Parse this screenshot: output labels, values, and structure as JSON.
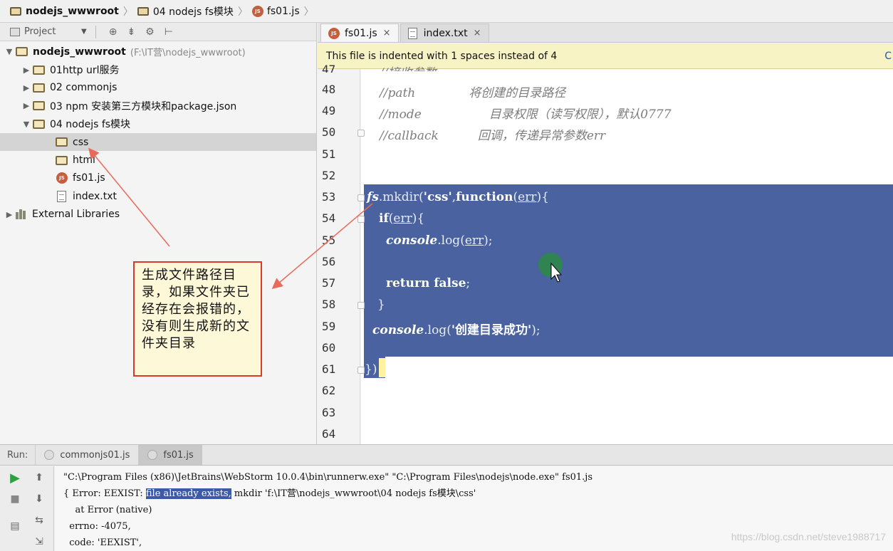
{
  "breadcrumb": {
    "items": [
      "nodejs_wwwroot",
      "04 nodejs fs模块",
      "fs01.js"
    ]
  },
  "project_panel": {
    "title": "Project",
    "root": {
      "name": "nodejs_wwwroot",
      "path": "(F:\\IT营\\nodejs_wwwroot)"
    },
    "items": [
      {
        "label": "01http url服务"
      },
      {
        "label": "02 commonjs"
      },
      {
        "label": "03 npm 安装第三方模块和package.json"
      },
      {
        "label": "04 nodejs fs模块"
      },
      {
        "label": "css"
      },
      {
        "label": "html"
      },
      {
        "label": "fs01.js"
      },
      {
        "label": "index.txt"
      },
      {
        "label": "External Libraries"
      }
    ]
  },
  "callout": {
    "text": "生成文件路径目录，如果文件夹已经存在会报错的，没有则生成新的文件夹目录"
  },
  "editor": {
    "tabs": [
      {
        "label": "fs01.js",
        "close": "×"
      },
      {
        "label": "index.txt",
        "close": "×"
      }
    ],
    "notice": "This file is indented with 1 spaces instead of 4",
    "notice_edge": "C",
    "line_numbers": [
      "47",
      "48",
      "49",
      "50",
      "51",
      "52",
      "53",
      "54",
      "55",
      "56",
      "57",
      "58",
      "59",
      "60",
      "61",
      "62",
      "63",
      "64"
    ],
    "code": {
      "l47": "//接收参数:",
      "l48a": "//path",
      "l48b": "将创建的目录路径",
      "l49a": "//mode",
      "l49b": "目录权限（读写权限），默认0777",
      "l50a": "//callback",
      "l50b": "回调，传递异常参数err",
      "l53_fs": "fs",
      "l53_rest": ".mkdir(",
      "l53_str": "'css'",
      "l53_comma": ",",
      "l53_fn": "function",
      "l53_open": "(",
      "l53_err": "err",
      "l53_close": "){",
      "l54_if": "if",
      "l54_open": "(",
      "l54_err": "err",
      "l54_close": "){",
      "l55_console": "console",
      "l55_log": ".log(",
      "l55_err": "err",
      "l55_close": ");",
      "l57_ret": "return false",
      "l57_semi": ";",
      "l58": "}",
      "l59_console": "console",
      "l59_log": ".log(",
      "l59_str": "'创建目录成功'",
      "l59_close": ");",
      "l61": "})"
    }
  },
  "run_panel": {
    "label": "Run:",
    "tabs": [
      "commonjs01.js",
      "fs01.js"
    ],
    "console": {
      "line1": "\"C:\\Program Files (x86)\\JetBrains\\WebStorm 10.0.4\\bin\\runnerw.exe\" \"C:\\Program Files\\nodejs\\node.exe\" fs01.js",
      "line2_pre": "{ Error: EEXIST: ",
      "line2_hl": "file already exists,",
      "line2_post": " mkdir 'f:\\IT营\\nodejs_wwwroot\\04 nodejs fs模块\\css'",
      "line3": "    at Error (native)",
      "line4": "  errno: -4075,",
      "line5": "  code: 'EEXIST',"
    }
  },
  "watermark": "https://blog.csdn.net/steve1988717",
  "colors": {
    "selection": "#4a63a0",
    "callout_border": "#d93a2a",
    "notice_bg": "#f8f3c5"
  }
}
